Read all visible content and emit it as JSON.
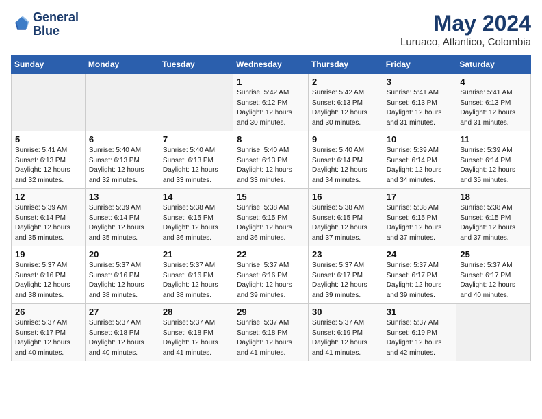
{
  "header": {
    "logo_line1": "General",
    "logo_line2": "Blue",
    "month_year": "May 2024",
    "location": "Luruaco, Atlantico, Colombia"
  },
  "weekdays": [
    "Sunday",
    "Monday",
    "Tuesday",
    "Wednesday",
    "Thursday",
    "Friday",
    "Saturday"
  ],
  "weeks": [
    [
      {
        "day": "",
        "info": ""
      },
      {
        "day": "",
        "info": ""
      },
      {
        "day": "",
        "info": ""
      },
      {
        "day": "1",
        "info": "Sunrise: 5:42 AM\nSunset: 6:12 PM\nDaylight: 12 hours\nand 30 minutes."
      },
      {
        "day": "2",
        "info": "Sunrise: 5:42 AM\nSunset: 6:13 PM\nDaylight: 12 hours\nand 30 minutes."
      },
      {
        "day": "3",
        "info": "Sunrise: 5:41 AM\nSunset: 6:13 PM\nDaylight: 12 hours\nand 31 minutes."
      },
      {
        "day": "4",
        "info": "Sunrise: 5:41 AM\nSunset: 6:13 PM\nDaylight: 12 hours\nand 31 minutes."
      }
    ],
    [
      {
        "day": "5",
        "info": "Sunrise: 5:41 AM\nSunset: 6:13 PM\nDaylight: 12 hours\nand 32 minutes."
      },
      {
        "day": "6",
        "info": "Sunrise: 5:40 AM\nSunset: 6:13 PM\nDaylight: 12 hours\nand 32 minutes."
      },
      {
        "day": "7",
        "info": "Sunrise: 5:40 AM\nSunset: 6:13 PM\nDaylight: 12 hours\nand 33 minutes."
      },
      {
        "day": "8",
        "info": "Sunrise: 5:40 AM\nSunset: 6:13 PM\nDaylight: 12 hours\nand 33 minutes."
      },
      {
        "day": "9",
        "info": "Sunrise: 5:40 AM\nSunset: 6:14 PM\nDaylight: 12 hours\nand 34 minutes."
      },
      {
        "day": "10",
        "info": "Sunrise: 5:39 AM\nSunset: 6:14 PM\nDaylight: 12 hours\nand 34 minutes."
      },
      {
        "day": "11",
        "info": "Sunrise: 5:39 AM\nSunset: 6:14 PM\nDaylight: 12 hours\nand 35 minutes."
      }
    ],
    [
      {
        "day": "12",
        "info": "Sunrise: 5:39 AM\nSunset: 6:14 PM\nDaylight: 12 hours\nand 35 minutes."
      },
      {
        "day": "13",
        "info": "Sunrise: 5:39 AM\nSunset: 6:14 PM\nDaylight: 12 hours\nand 35 minutes."
      },
      {
        "day": "14",
        "info": "Sunrise: 5:38 AM\nSunset: 6:15 PM\nDaylight: 12 hours\nand 36 minutes."
      },
      {
        "day": "15",
        "info": "Sunrise: 5:38 AM\nSunset: 6:15 PM\nDaylight: 12 hours\nand 36 minutes."
      },
      {
        "day": "16",
        "info": "Sunrise: 5:38 AM\nSunset: 6:15 PM\nDaylight: 12 hours\nand 37 minutes."
      },
      {
        "day": "17",
        "info": "Sunrise: 5:38 AM\nSunset: 6:15 PM\nDaylight: 12 hours\nand 37 minutes."
      },
      {
        "day": "18",
        "info": "Sunrise: 5:38 AM\nSunset: 6:15 PM\nDaylight: 12 hours\nand 37 minutes."
      }
    ],
    [
      {
        "day": "19",
        "info": "Sunrise: 5:37 AM\nSunset: 6:16 PM\nDaylight: 12 hours\nand 38 minutes."
      },
      {
        "day": "20",
        "info": "Sunrise: 5:37 AM\nSunset: 6:16 PM\nDaylight: 12 hours\nand 38 minutes."
      },
      {
        "day": "21",
        "info": "Sunrise: 5:37 AM\nSunset: 6:16 PM\nDaylight: 12 hours\nand 38 minutes."
      },
      {
        "day": "22",
        "info": "Sunrise: 5:37 AM\nSunset: 6:16 PM\nDaylight: 12 hours\nand 39 minutes."
      },
      {
        "day": "23",
        "info": "Sunrise: 5:37 AM\nSunset: 6:17 PM\nDaylight: 12 hours\nand 39 minutes."
      },
      {
        "day": "24",
        "info": "Sunrise: 5:37 AM\nSunset: 6:17 PM\nDaylight: 12 hours\nand 39 minutes."
      },
      {
        "day": "25",
        "info": "Sunrise: 5:37 AM\nSunset: 6:17 PM\nDaylight: 12 hours\nand 40 minutes."
      }
    ],
    [
      {
        "day": "26",
        "info": "Sunrise: 5:37 AM\nSunset: 6:17 PM\nDaylight: 12 hours\nand 40 minutes."
      },
      {
        "day": "27",
        "info": "Sunrise: 5:37 AM\nSunset: 6:18 PM\nDaylight: 12 hours\nand 40 minutes."
      },
      {
        "day": "28",
        "info": "Sunrise: 5:37 AM\nSunset: 6:18 PM\nDaylight: 12 hours\nand 41 minutes."
      },
      {
        "day": "29",
        "info": "Sunrise: 5:37 AM\nSunset: 6:18 PM\nDaylight: 12 hours\nand 41 minutes."
      },
      {
        "day": "30",
        "info": "Sunrise: 5:37 AM\nSunset: 6:19 PM\nDaylight: 12 hours\nand 41 minutes."
      },
      {
        "day": "31",
        "info": "Sunrise: 5:37 AM\nSunset: 6:19 PM\nDaylight: 12 hours\nand 42 minutes."
      },
      {
        "day": "",
        "info": ""
      }
    ]
  ]
}
